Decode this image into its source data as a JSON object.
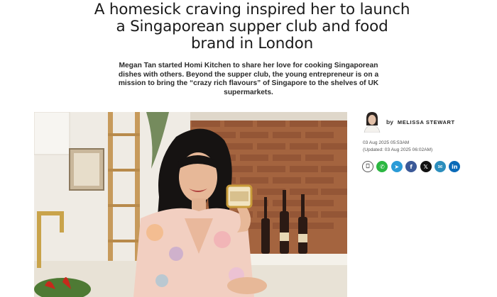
{
  "article": {
    "headline": "A homesick craving inspired her to launch a Singaporean supper club and food brand in London",
    "standfirst": "Megan Tan started Homi Kitchen to share her love for cooking Singaporean dishes with others. Beyond the supper club, the young entrepreneur is on a mission to bring the “crazy rich flavours” of Singapore to the shelves of UK supermarkets."
  },
  "author": {
    "by_label": "by",
    "name": "MELISSA STEWART"
  },
  "dates": {
    "published": "03 Aug 2025 05:53AM",
    "updated": "(Updated: 03 Aug 2025 06:02AM)"
  },
  "share": {
    "icons": [
      "bookmark-icon",
      "whatsapp-icon",
      "telegram-icon",
      "facebook-icon",
      "x-icon",
      "email-icon",
      "linkedin-icon"
    ],
    "facebook_glyph": "f",
    "x_glyph": "𝕏",
    "linkedin_glyph": "in",
    "telegram_glyph": "➤",
    "whatsapp_glyph": "✆",
    "email_glyph": "✉",
    "bookmark_glyph": "⎕"
  },
  "colors": {
    "whatsapp": "#2bb741",
    "telegram": "#2a9bd7",
    "facebook": "#3b5998",
    "x": "#111111",
    "email": "#2c8ebd",
    "linkedin": "#0a6ab8"
  }
}
